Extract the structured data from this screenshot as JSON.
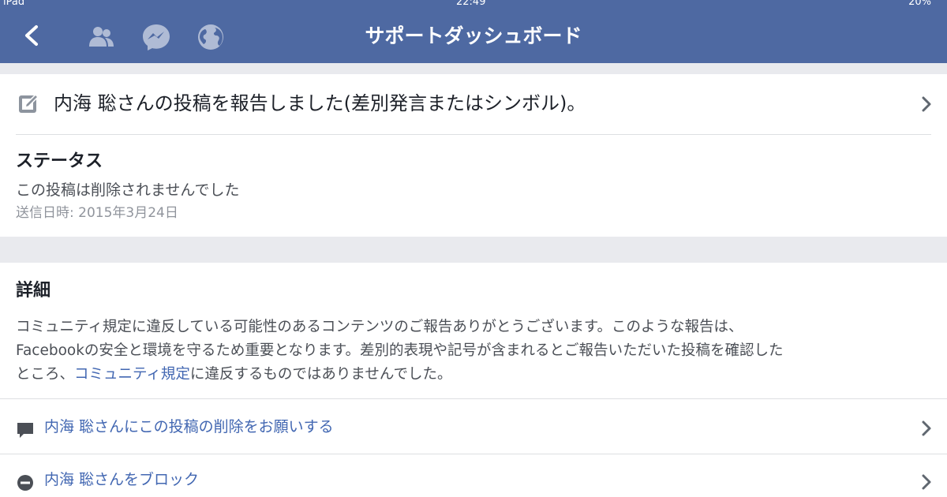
{
  "status_bar": {
    "left": "iPad",
    "time": "22:49",
    "battery": "20%"
  },
  "nav": {
    "title": "サポートダッシュボード",
    "icons": [
      "back-icon",
      "friends-icon",
      "messenger-icon",
      "globe-icon"
    ]
  },
  "report": {
    "text": "内海 聡さんの投稿を報告しました(差別発言またはシンボル)。",
    "icon": "edit-icon"
  },
  "status": {
    "heading": "ステータス",
    "text": "この投稿は削除されませんでした",
    "date": "送信日時: 2015年3月24日"
  },
  "details": {
    "heading": "詳細",
    "line1": "コミュニティ規定に違反している可能性のあるコンテンツのご報告ありがとうございます。このような報告は、",
    "line2": "Facebookの安全と環境を守るため重要となります。差別的表現や記号が含まれるとご報告いただいた投稿を確認した",
    "line3_prefix": "ところ、",
    "line3_link": "コミュニティ規定",
    "line3_suffix": "に違反するものではありませんでした。"
  },
  "actions": [
    {
      "label": "内海 聡さんにこの投稿の削除をお願いする",
      "icon": "speech-bubble-icon"
    },
    {
      "label": "内海 聡さんをブロック",
      "icon": "block-icon"
    }
  ],
  "colors": {
    "nav_blue": "#4e69a2",
    "link_blue": "#4267b2",
    "background_gray": "#e9eaee",
    "text_dark": "#1d2129",
    "text_secondary": "#4b4f56",
    "text_muted": "#90949c"
  }
}
